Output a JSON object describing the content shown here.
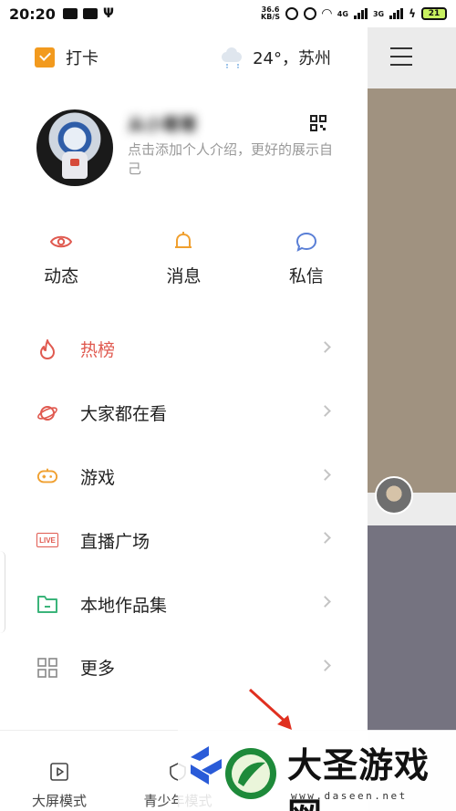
{
  "status_bar": {
    "time": "20:20",
    "net_speed_value": "36.6",
    "net_speed_unit": "KB/S",
    "signal_1": "4G",
    "signal_2": "3G",
    "battery": "21"
  },
  "drawer": {
    "checkin_label": "打卡",
    "weather_text": "24°，苏州",
    "profile": {
      "username": "从小哥哥",
      "bio": "点击添加个人介绍，更好的展示自己"
    },
    "quick_actions": [
      {
        "label": "动态",
        "icon": "eye-icon",
        "color": "#e05a50"
      },
      {
        "label": "消息",
        "icon": "bell-icon",
        "color": "#f0a030"
      },
      {
        "label": "私信",
        "icon": "chat-bubble-icon",
        "color": "#5a7fd6"
      }
    ],
    "menu": [
      {
        "label": "热榜",
        "icon": "flame-icon"
      },
      {
        "label": "大家都在看",
        "icon": "planet-icon"
      },
      {
        "label": "游戏",
        "icon": "gamepad-icon"
      },
      {
        "label": "直播广场",
        "icon": "live-icon",
        "tag": "LIVE"
      },
      {
        "label": "本地作品集",
        "icon": "folder-icon"
      },
      {
        "label": "更多",
        "icon": "grid-icon"
      }
    ],
    "bottom_bar": [
      {
        "label": "大屏模式",
        "icon": "play-screen-icon"
      },
      {
        "label": "青少年模式",
        "icon": "shield-icon"
      }
    ]
  },
  "watermark": {
    "title": "大圣游戏网",
    "url": "www.daseen.net"
  },
  "colors": {
    "accent_red": "#e05a50",
    "accent_orange": "#f29a1e",
    "accent_blue": "#5a7fd6",
    "accent_green": "#3bb47a"
  }
}
